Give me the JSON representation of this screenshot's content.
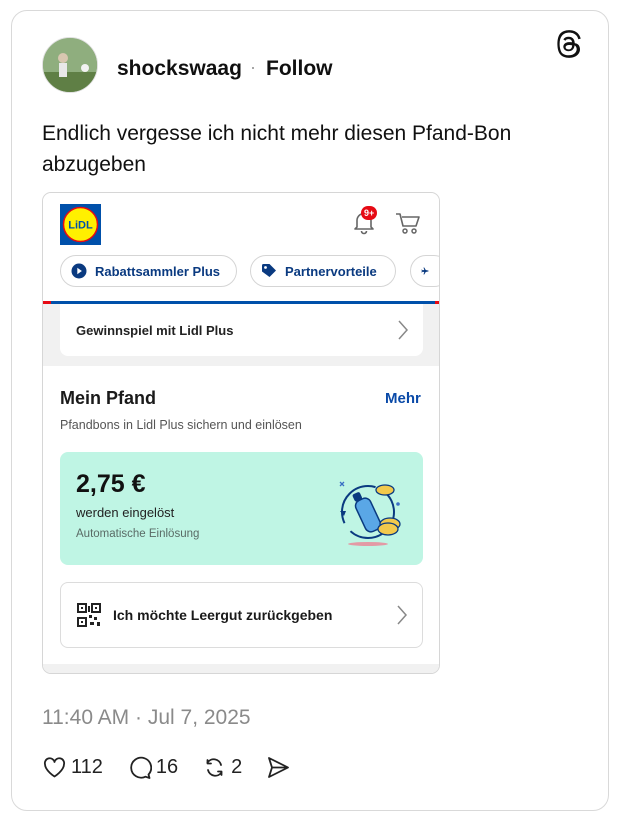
{
  "post": {
    "username": "shockswaag",
    "separator": "·",
    "follow_label": "Follow",
    "text": "Endlich vergesse ich nicht mehr diesen Pfand-Bon abzugeben",
    "timestamp": "11:40 AM · Jul 7, 2025",
    "likes": "112",
    "replies": "16",
    "reposts": "2",
    "logo_icon": "threads-logo-icon"
  },
  "screenshot": {
    "logo_text": "LiDL",
    "notification_badge": "9+",
    "chips": [
      {
        "label": "Rabattsammler Plus",
        "icon": "play-circle-icon"
      },
      {
        "label": "Partnervorteile",
        "icon": "tag-icon"
      },
      {
        "label": "",
        "icon": "airplane-icon"
      }
    ],
    "gewinnspiel_label": "Gewinnspiel mit Lidl Plus",
    "pfand": {
      "title": "Mein Pfand",
      "more_label": "Mehr",
      "subtitle": "Pfandbons in Lidl Plus sichern und einlösen",
      "amount": "2,75 €",
      "status": "werden eingelöst",
      "note": "Automatische Einlösung",
      "return_label": "Ich möchte Leergut zurückgeben"
    },
    "colors": {
      "lidl_blue": "#0050aa",
      "lidl_red": "#e60a14",
      "lidl_yellow": "#fff000",
      "mint_card": "#bff5e4",
      "link_blue": "#0a4aa8"
    }
  }
}
